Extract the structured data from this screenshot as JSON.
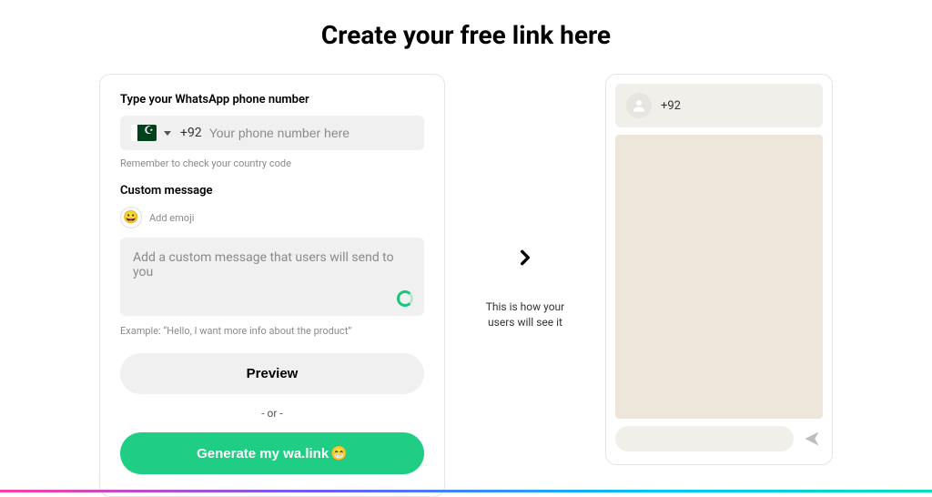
{
  "title": "Create your free link here",
  "form": {
    "phone_label": "Type your WhatsApp phone number",
    "dial_code": "+92",
    "phone_placeholder": "Your phone number here",
    "phone_hint": "Remember to check your country code",
    "message_label": "Custom message",
    "emoji_label": "Add emoji",
    "message_placeholder": "Add a custom message that users will send to you",
    "example": "Example: “Hello, I want more info about the product”",
    "preview_button": "Preview",
    "or": "- or -",
    "generate_button": "Generate my wa.link",
    "generate_emoji": "😁"
  },
  "middle_text_line1": "This is how your",
  "middle_text_line2": "users will see it",
  "preview": {
    "contact_display": "+92"
  },
  "country": {
    "flag_label": "pakistan-flag-icon"
  }
}
